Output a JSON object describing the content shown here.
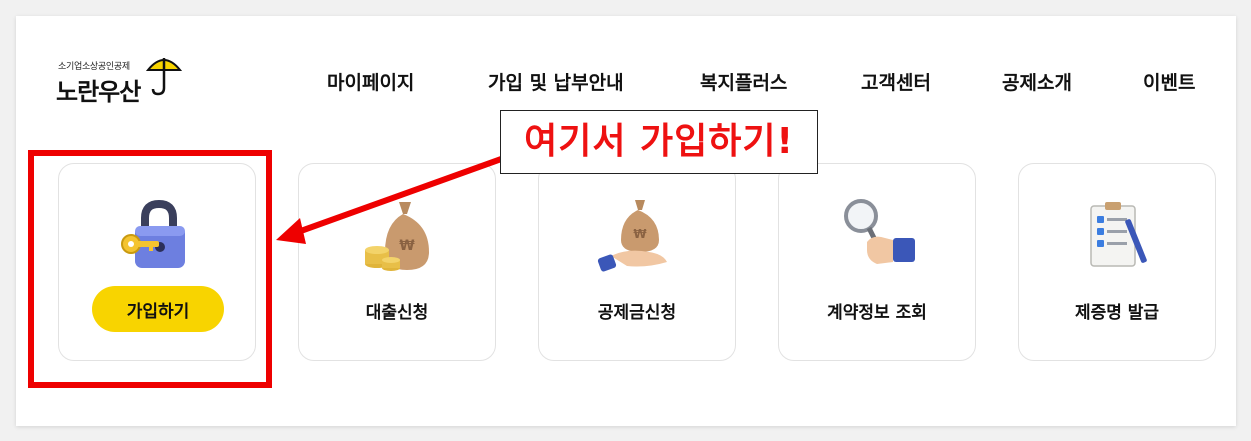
{
  "logo": {
    "subtitle": "소기업소상공인공제",
    "name": "노란우산"
  },
  "nav": {
    "items": [
      {
        "label": "마이페이지"
      },
      {
        "label": "가입 및 납부안내"
      },
      {
        "label": "복지플러스"
      },
      {
        "label": "고객센터"
      },
      {
        "label": "공제소개"
      },
      {
        "label": "이벤트"
      }
    ]
  },
  "cards": [
    {
      "label": "가입하기",
      "icon": "padlock-key-icon"
    },
    {
      "label": "대출신청",
      "icon": "money-bag-coins-icon"
    },
    {
      "label": "공제금신청",
      "icon": "hand-money-bag-icon"
    },
    {
      "label": "계약정보 조회",
      "icon": "magnifier-hand-icon"
    },
    {
      "label": "제증명 발급",
      "icon": "clipboard-checklist-icon"
    }
  ],
  "annotation": {
    "callout_text": "여기서 가입하기!",
    "color": "#ee0000"
  },
  "colors": {
    "accent_yellow": "#f8d400",
    "annotation_red": "#ee0000"
  }
}
